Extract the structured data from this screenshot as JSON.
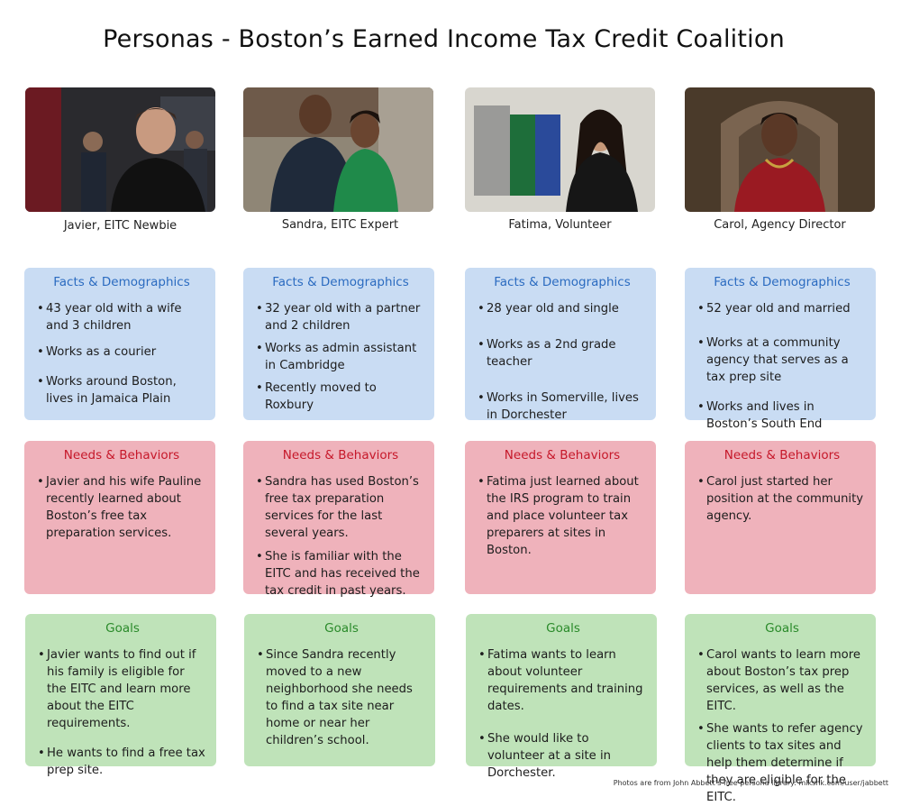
{
  "title": "Personas - Boston’s Earned Income Tax Credit Coalition",
  "personas": [
    {
      "name": "Javier, EITC Newbie",
      "facts_title": "Facts & Demographics",
      "facts": [
        "43 year old with a wife and 3 children",
        "Works as a courier",
        "Works around Boston, lives in Jamaica Plain"
      ],
      "needs_title": "Needs & Behaviors",
      "needs": [
        "Javier and his wife Pauline recently learned about Boston’s free tax preparation services."
      ],
      "goals_title": "Goals",
      "goals": [
        "Javier wants to find out if his family is eligible for the EITC and learn more about the EITC requirements.",
        "He wants to find a free tax prep site."
      ]
    },
    {
      "name": "Sandra, EITC Expert",
      "facts_title": "Facts & Demographics",
      "facts": [
        "32 year old with a partner and 2 children",
        "Works as admin assistant in Cambridge",
        "Recently moved to Roxbury"
      ],
      "needs_title": "Needs & Behaviors",
      "needs": [
        "Sandra has used Boston’s free tax preparation services for the last several years.",
        "She is familiar with the EITC and has received the tax credit in past years."
      ],
      "goals_title": "Goals",
      "goals": [
        "Since Sandra recently moved to a new neighborhood she needs to find a tax site near home or near her children’s school."
      ]
    },
    {
      "name": "Fatima, Volunteer",
      "facts_title": "Facts & Demographics",
      "facts": [
        "28 year old and single",
        "Works as a 2nd grade teacher",
        "Works in Somerville, lives in Dorchester"
      ],
      "needs_title": "Needs & Behaviors",
      "needs": [
        "Fatima just learned about the IRS program to train and place volunteer tax preparers at sites in Boston."
      ],
      "goals_title": "Goals",
      "goals": [
        "Fatima wants to learn about volunteer requirements and training dates.",
        "She would like to volunteer at a site in Dorchester."
      ]
    },
    {
      "name": "Carol, Agency Director",
      "facts_title": "Facts & Demographics",
      "facts": [
        "52 year old and married",
        "Works at a community agency that serves as a tax prep site",
        "Works and lives in Boston’s South End"
      ],
      "needs_title": "Needs & Behaviors",
      "needs": [
        "Carol just started her position at the community agency."
      ],
      "goals_title": "Goals",
      "goals": [
        "Carol wants to learn more about Boston’s tax prep services, as well as the EITC.",
        "She wants to refer agency clients to tax sites and help them determine if they are eligible for the EITC."
      ]
    }
  ],
  "footnote": "Photos are from John Abbett’s free persona library: mlkshk.com/user/jabbett"
}
